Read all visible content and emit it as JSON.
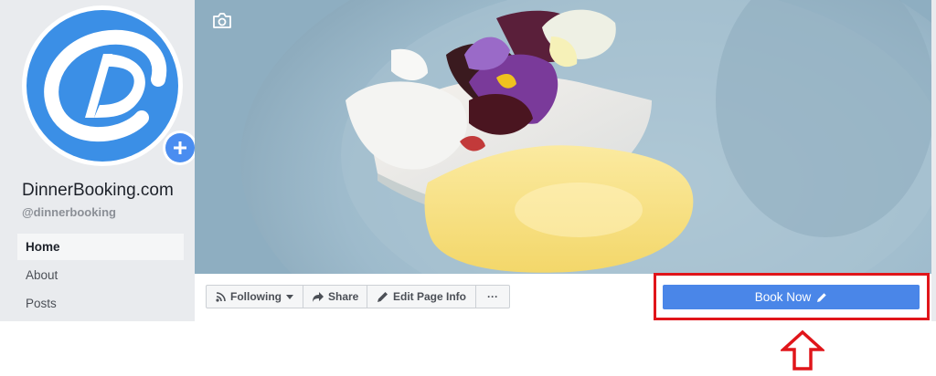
{
  "profile": {
    "name": "DinnerBooking.com",
    "handle": "@dinnerbooking",
    "avatar_icon": "dinnerbooking-logo",
    "add_icon": "plus-icon"
  },
  "sidebar": {
    "items": [
      {
        "label": "Home",
        "active": true
      },
      {
        "label": "About",
        "active": false
      },
      {
        "label": "Posts",
        "active": false
      }
    ]
  },
  "cover": {
    "camera_icon": "camera-icon"
  },
  "actions": {
    "following_label": "Following",
    "share_label": "Share",
    "edit_label": "Edit Page Info",
    "more_label": "···",
    "book_label": "Book Now"
  },
  "annotation": {
    "highlight_color": "#e0151a",
    "arrow_icon": "up-arrow-icon"
  },
  "colors": {
    "accent": "#4a86e8",
    "page_background": "#e9ebee",
    "text": "#1d2129"
  }
}
